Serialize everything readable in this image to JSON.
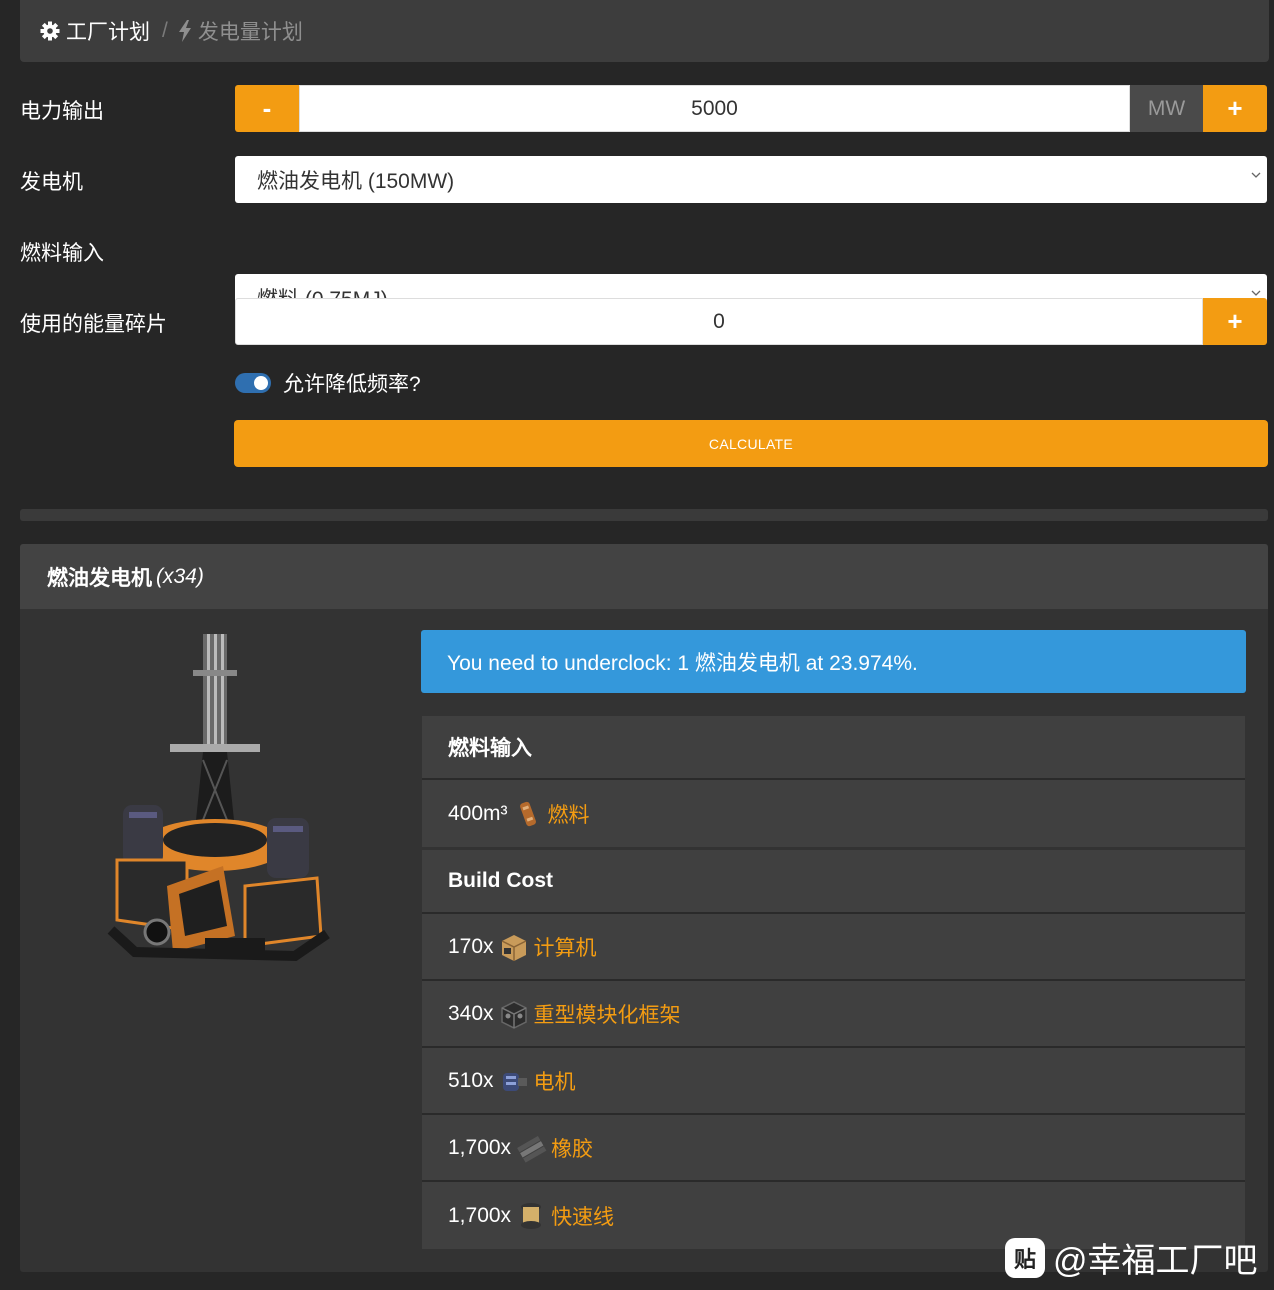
{
  "breadcrumb": {
    "home_label": "工厂计划",
    "separator": "/",
    "current_label": "发电量计划"
  },
  "form": {
    "power_output": {
      "label": "电力输出",
      "minus_label": "-",
      "value": "5000",
      "unit": "MW",
      "plus_label": "+"
    },
    "generator": {
      "label": "发电机",
      "selected": "燃油发电机 (150MW)"
    },
    "fuel_input": {
      "label": "燃料输入",
      "selected": "燃料 (0.75MJ)"
    },
    "power_shards": {
      "label": "使用的能量碎片",
      "value": "0",
      "plus_label": "+"
    },
    "underclock_toggle": {
      "label": "允许降低频率?",
      "checked": true
    },
    "calculate_label": "CALCULATE"
  },
  "result": {
    "title": "燃油发电机",
    "count": "(x34)",
    "alert": "You need to underclock: 1 燃油发电机 at 23.974%.",
    "fuel_section": {
      "header": "燃料输入",
      "rows": [
        {
          "amount": "400m³",
          "item": "燃料",
          "icon": "fuel-canister-icon"
        }
      ]
    },
    "build_cost": {
      "header": "Build Cost",
      "rows": [
        {
          "amount": "170x",
          "item": "计算机",
          "icon": "computer-box-icon"
        },
        {
          "amount": "340x",
          "item": "重型模块化框架",
          "icon": "heavy-frame-icon"
        },
        {
          "amount": "510x",
          "item": "电机",
          "icon": "motor-icon"
        },
        {
          "amount": "1,700x",
          "item": "橡胶",
          "icon": "rubber-icon"
        },
        {
          "amount": "1,700x",
          "item": "快速线",
          "icon": "quickwire-spool-icon"
        }
      ]
    }
  },
  "watermark": {
    "logo": "贴",
    "text": "@幸福工厂吧"
  },
  "colors": {
    "accent": "#f39c12",
    "info": "#3498db",
    "background": "#262626",
    "panel": "#3d3d3d",
    "toggle": "#2f6fb0"
  }
}
